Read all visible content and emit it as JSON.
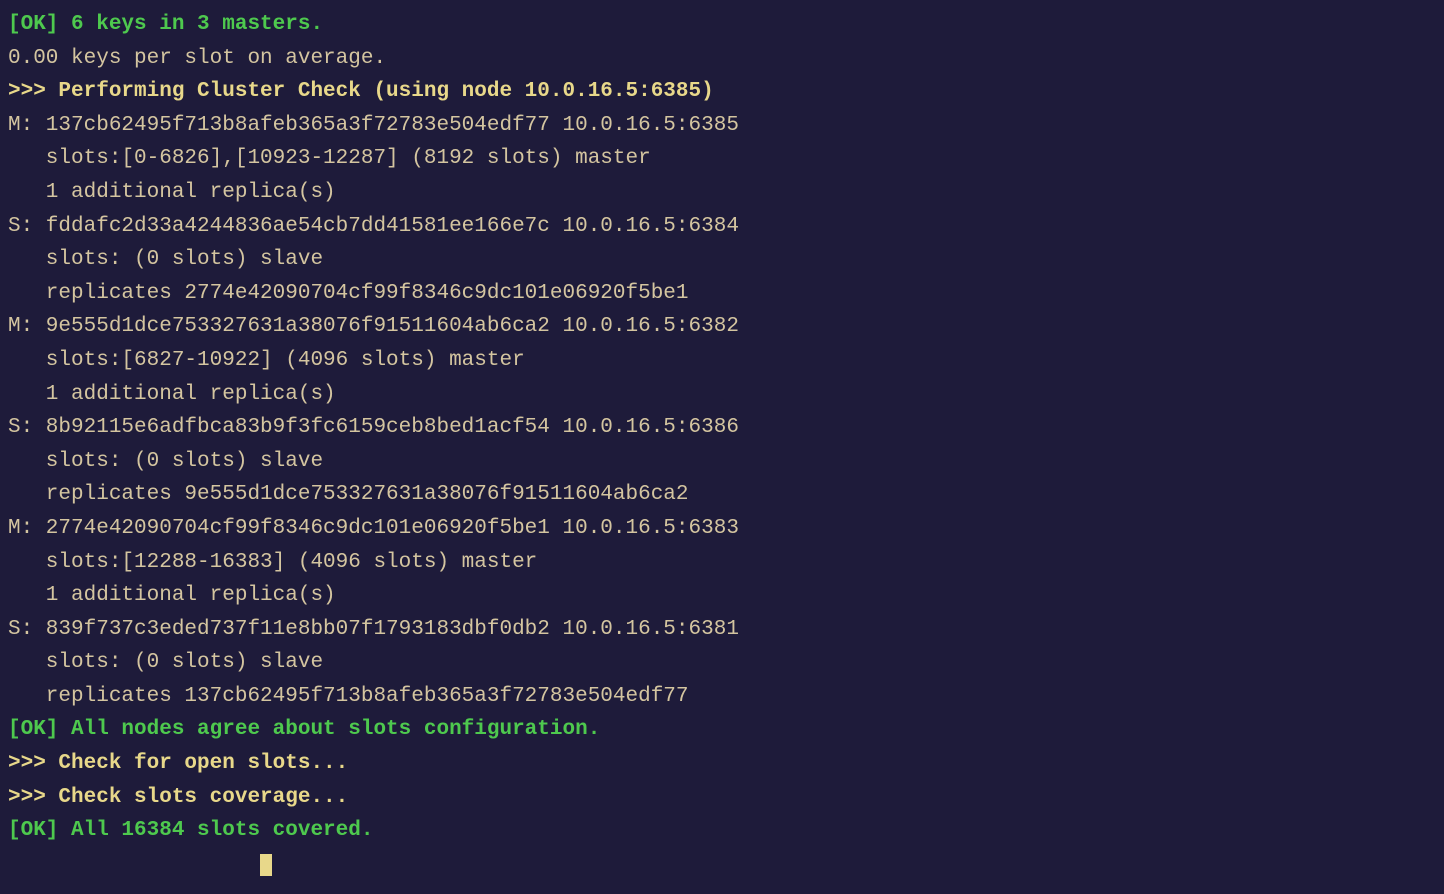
{
  "terminal": {
    "ok_keys": "[OK] 6 keys in 3 masters.",
    "avg": "0.00 keys per slot on average.",
    "cluster_check": ">>> Performing Cluster Check (using node 10.0.16.5:6385)",
    "node1": {
      "header": "M: 137cb62495f713b8afeb365a3f72783e504edf77 10.0.16.5:6385",
      "slots": "   slots:[0-6826],[10923-12287] (8192 slots) master",
      "replica": "   1 additional replica(s)"
    },
    "node2": {
      "header": "S: fddafc2d33a4244836ae54cb7dd41581ee166e7c 10.0.16.5:6384",
      "slots": "   slots: (0 slots) slave",
      "replicates": "   replicates 2774e42090704cf99f8346c9dc101e06920f5be1"
    },
    "node3": {
      "header": "M: 9e555d1dce753327631a38076f91511604ab6ca2 10.0.16.5:6382",
      "slots": "   slots:[6827-10922] (4096 slots) master",
      "replica": "   1 additional replica(s)"
    },
    "node4": {
      "header": "S: 8b92115e6adfbca83b9f3fc6159ceb8bed1acf54 10.0.16.5:6386",
      "slots": "   slots: (0 slots) slave",
      "replicates": "   replicates 9e555d1dce753327631a38076f91511604ab6ca2"
    },
    "node5": {
      "header": "M: 2774e42090704cf99f8346c9dc101e06920f5be1 10.0.16.5:6383",
      "slots": "   slots:[12288-16383] (4096 slots) master",
      "replica": "   1 additional replica(s)"
    },
    "node6": {
      "header": "S: 839f737c3eded737f11e8bb07f1793183dbf0db2 10.0.16.5:6381",
      "slots": "   slots: (0 slots) slave",
      "replicates": "   replicates 137cb62495f713b8afeb365a3f72783e504edf77"
    },
    "ok_nodes": "[OK] All nodes agree about slots configuration.",
    "check_open": ">>> Check for open slots...",
    "check_coverage": ">>> Check slots coverage...",
    "ok_covered": "[OK] All 16384 slots covered."
  }
}
